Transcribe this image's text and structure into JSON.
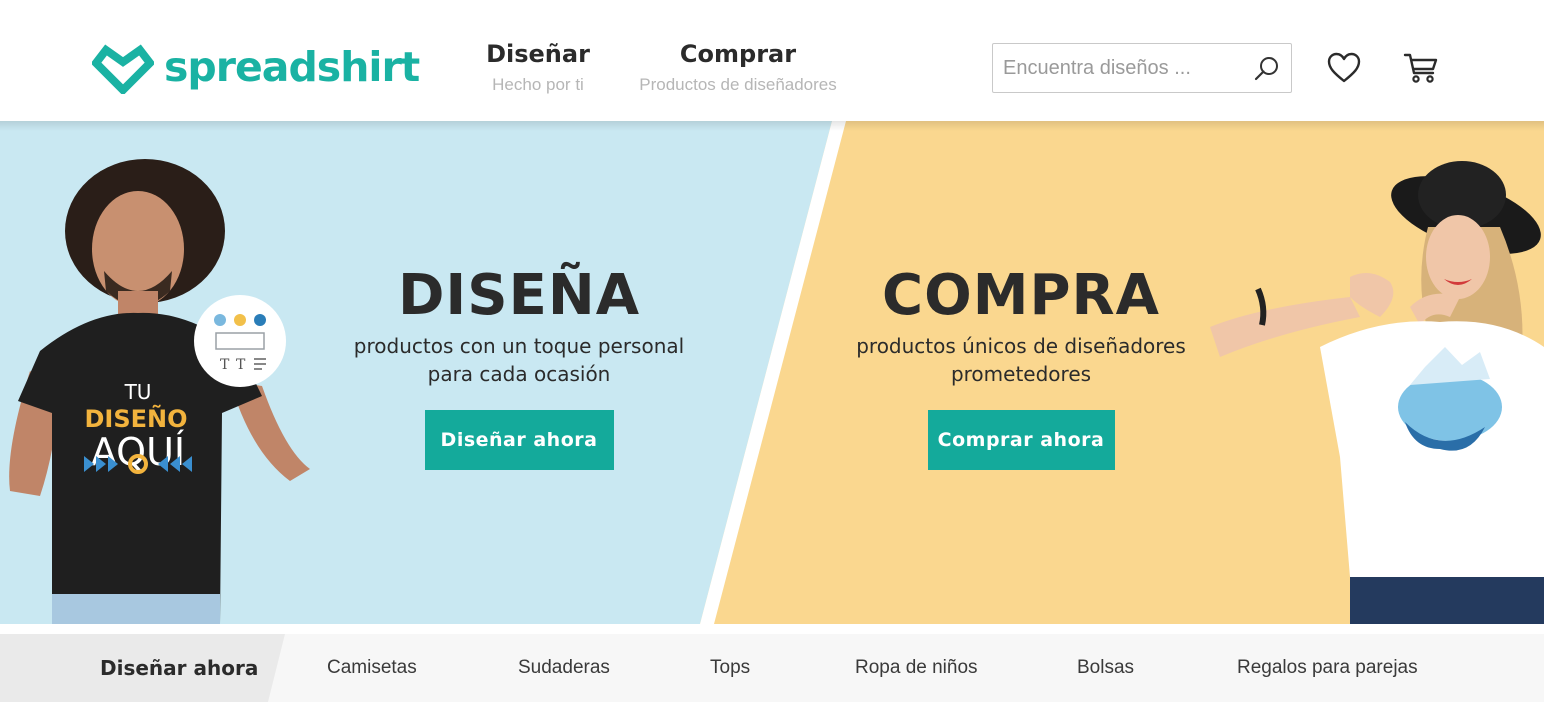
{
  "brand": {
    "name": "spreadshirt",
    "color": "#1ab2a3"
  },
  "nav": {
    "design": {
      "label": "Diseñar",
      "sub": "Hecho por ti"
    },
    "shop": {
      "label": "Comprar",
      "sub": "Productos de diseñadores"
    }
  },
  "search": {
    "placeholder": "Encuentra diseños ...",
    "value": ""
  },
  "icons": {
    "search": "search-icon",
    "wishlist": "heart-icon",
    "cart": "cart-icon"
  },
  "hero": {
    "left": {
      "headline": "DISEÑA",
      "description_line1": "productos con un toque personal",
      "description_line2": "para cada ocasión",
      "cta": "Diseñar ahora",
      "background": "#c9e8f2"
    },
    "right": {
      "headline": "COMPRA",
      "description_line1": "productos únicos de diseñadores",
      "description_line2": "prometedores",
      "cta": "Comprar ahora",
      "background": "#fad78f"
    },
    "tshirt_print": {
      "line1": "TU",
      "line2": "DISEÑO",
      "line3": "AQUÍ"
    },
    "accent_color": "#14aa9b"
  },
  "categories": {
    "active": "Diseñar ahora",
    "items": [
      "Camisetas",
      "Sudaderas",
      "Tops",
      "Ropa de niños",
      "Bolsas",
      "Regalos para parejas"
    ]
  }
}
